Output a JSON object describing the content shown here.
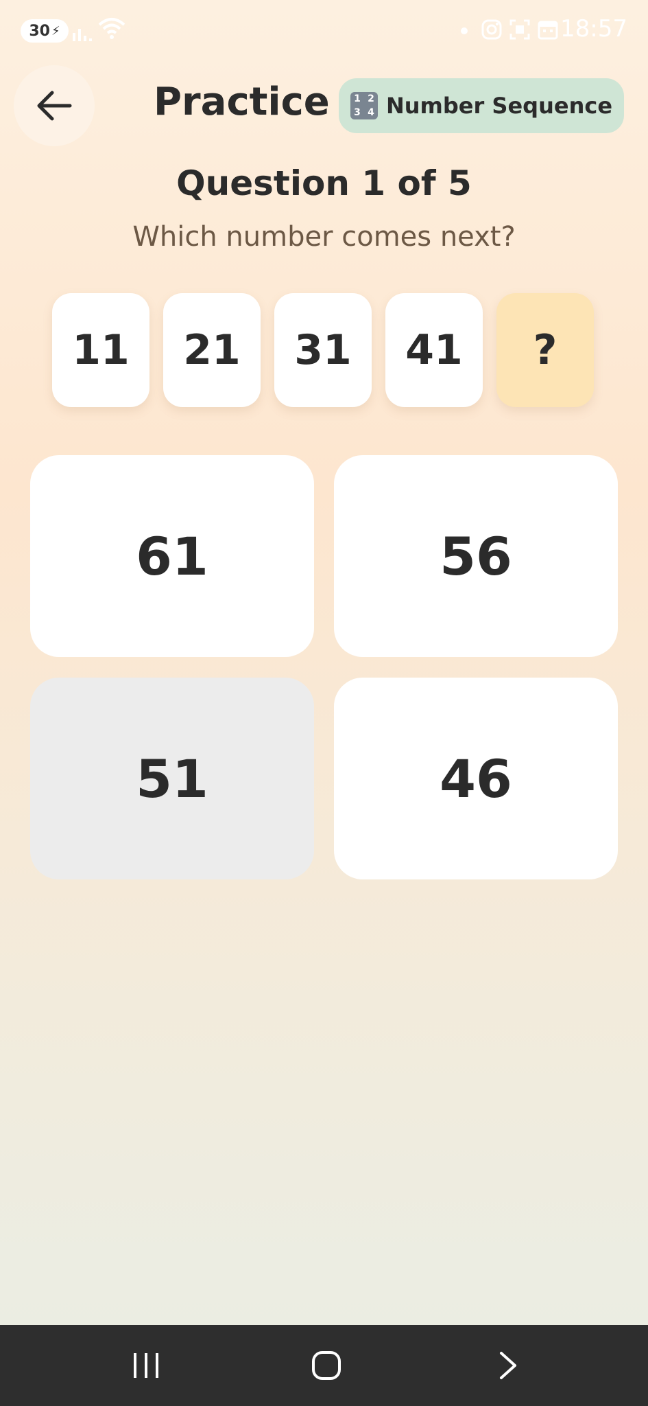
{
  "status_bar": {
    "battery_level": "30",
    "time": "18:57",
    "icons": [
      "signal-icon",
      "wifi-icon",
      "notification-dot-icon",
      "instagram-icon",
      "scan-icon",
      "calendar-icon"
    ]
  },
  "header": {
    "title": "Practice",
    "category_chip": {
      "icon": "number-keypad-icon",
      "icon_digits": [
        "1",
        "2",
        "3",
        "4"
      ],
      "label": "Number Sequence"
    }
  },
  "question": {
    "counter": "Question 1 of 5",
    "prompt": "Which number comes next?"
  },
  "sequence": [
    "11",
    "21",
    "31",
    "41",
    "?"
  ],
  "options": [
    {
      "label": "61",
      "state": "default"
    },
    {
      "label": "56",
      "state": "default"
    },
    {
      "label": "51",
      "state": "pressed"
    },
    {
      "label": "46",
      "state": "default"
    }
  ],
  "colors": {
    "chip_background": "#cfe5d5",
    "unknown_tile": "#fde4b5",
    "pressed_option": "#ececec",
    "navbar": "#2e2e2e"
  }
}
